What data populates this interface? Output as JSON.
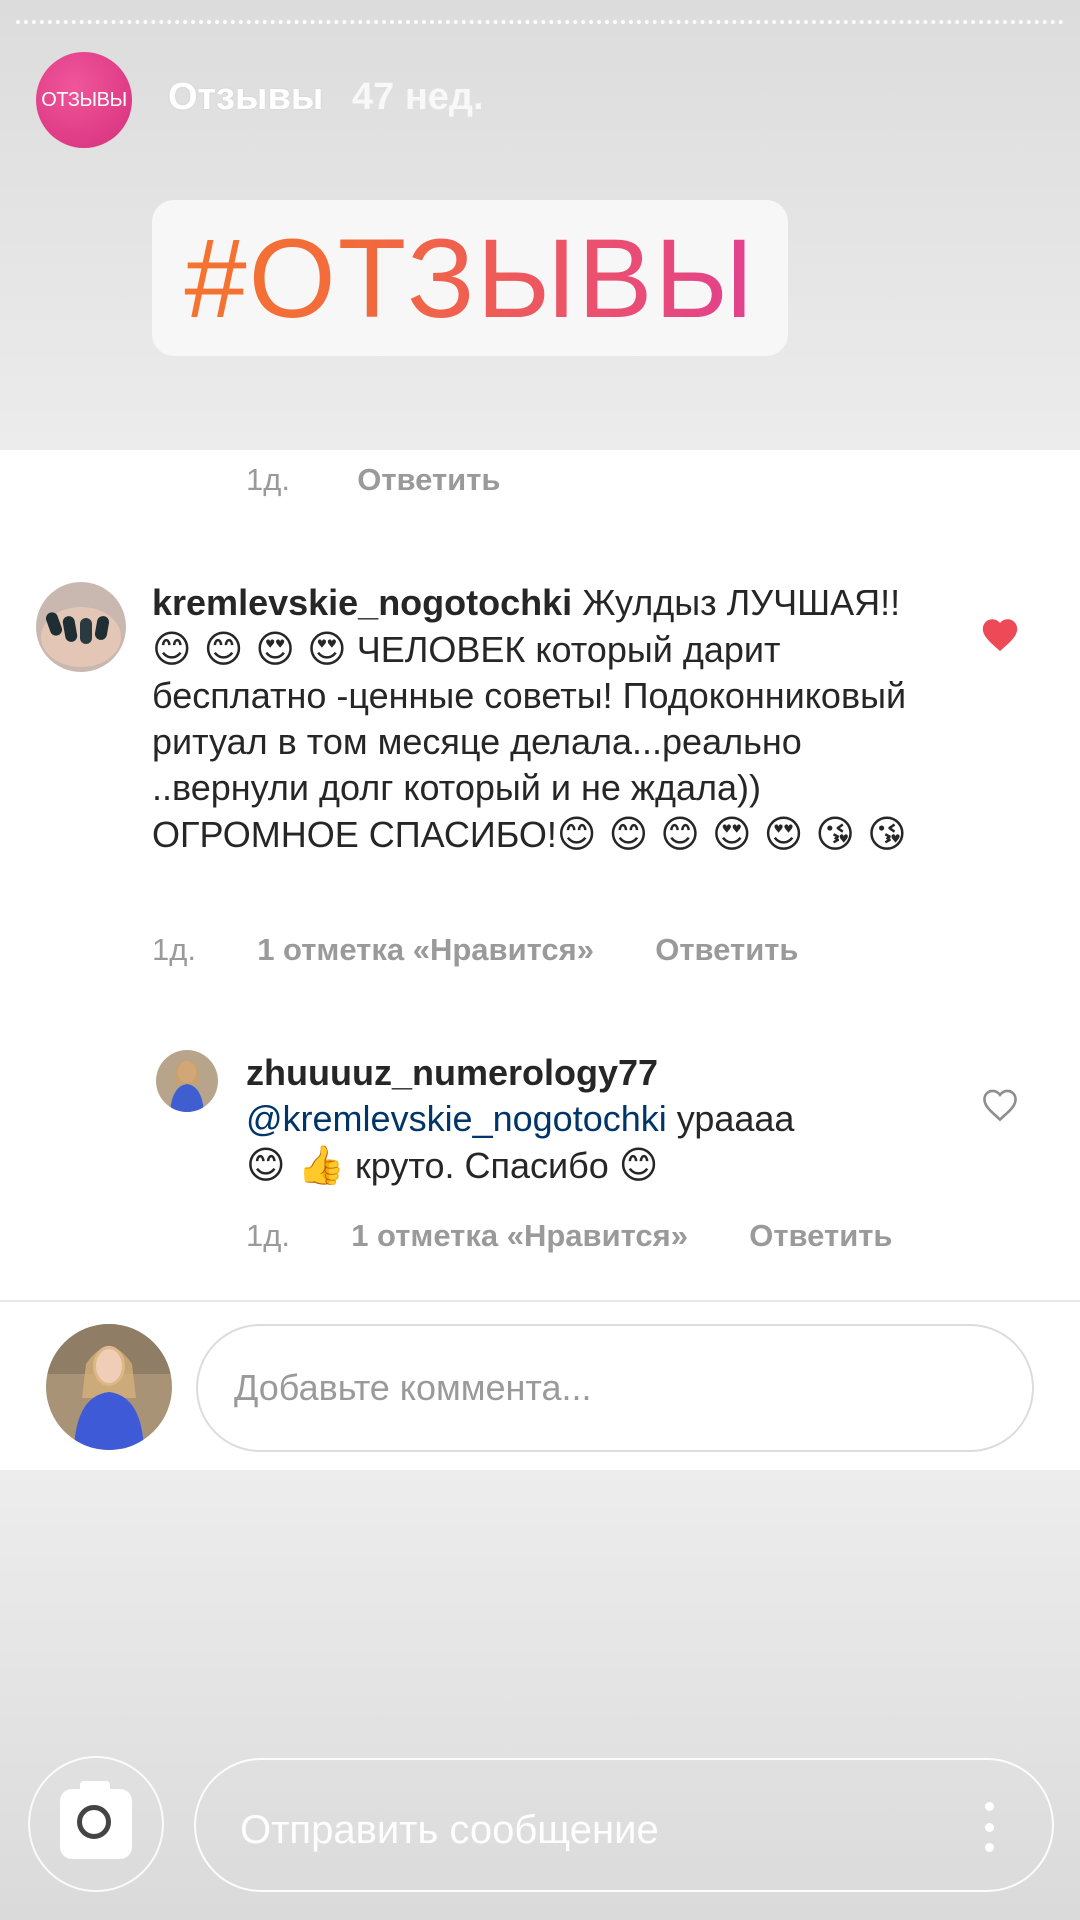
{
  "story": {
    "avatar_text": "ОТЗЫВЫ",
    "username": "Отзывы",
    "time": "47 нед.",
    "sticker_text": "#ОТЗЫВЫ"
  },
  "prev_comment_meta": {
    "time": "1д.",
    "reply": "Ответить"
  },
  "comments": [
    {
      "username": "kremlevskie_nogotochki",
      "text_part1": "Жулдыз ЛУЧШАЯ!!",
      "emojis1": "😊 😊 😍 😍",
      "text_part2": " ЧЕЛОВЕК который дарит бесплатно -ценные советы!  Подоконниковый ритуал в том месяце делала...реально ..вернули долг который и не ждала)) ОГРОМНОЕ СПАСИБО!",
      "emojis2": "😊 😊 😊 😍 😍 😘 😘",
      "time": "1д.",
      "likes": "1 отметка «Нравится»",
      "reply": "Ответить",
      "liked": true,
      "heart_icon": "heart-filled-icon",
      "heart_color": "#ed4956"
    },
    {
      "username": "zhuuuuz_numerology77",
      "mention": "@kremlevskie_nogotochki",
      "text_part1": " урааaa",
      "emojis1": "😊 👍",
      "text_part2": " круто. Спасибо ",
      "emojis2": "😊",
      "time": "1д.",
      "likes": "1 отметка «Нравится»",
      "reply": "Ответить",
      "liked": false,
      "heart_icon": "heart-outline-icon"
    }
  ],
  "comment_input": {
    "placeholder": "Добавьте коммента..."
  },
  "story_reply": {
    "placeholder": "Отправить сообщение",
    "camera_icon": "camera-icon",
    "more_icon": "more-vertical-icon"
  }
}
